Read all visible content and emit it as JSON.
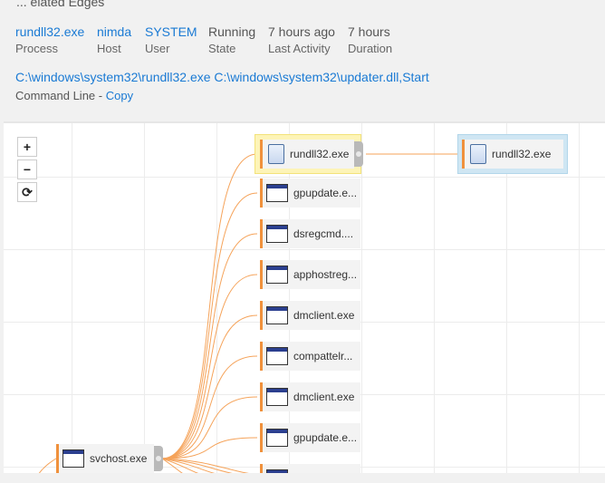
{
  "header_cut_text": "... elated Edges",
  "summary": {
    "fields": [
      {
        "value": "rundll32.exe",
        "label": "Process",
        "link": true
      },
      {
        "value": "nimda",
        "label": "Host",
        "link": true
      },
      {
        "value": "SYSTEM",
        "label": "User",
        "link": true
      },
      {
        "value": "Running",
        "label": "State",
        "link": false
      },
      {
        "value": "7 hours ago",
        "label": "Last Activity",
        "link": false
      },
      {
        "value": "7 hours",
        "label": "Duration",
        "link": false
      }
    ],
    "command_line": "C:\\windows\\system32\\rundll32.exe C:\\windows\\system32\\updater.dll,Start",
    "command_line_label": "Command Line - ",
    "copy_label": "Copy"
  },
  "graph": {
    "zoom_in": "+",
    "zoom_out": "−",
    "reset": "⟳",
    "root_node": "svchost.exe",
    "selected_node": "rundll32.exe",
    "related_node": "rundll32.exe",
    "children": [
      "gpupdate.e...",
      "dsregcmd....",
      "apphostreg...",
      "dmclient.exe",
      "compattelr...",
      "dmclient.exe",
      "gpupdate.e...",
      ""
    ],
    "colors": {
      "edge": "#f5a35a",
      "accent": "#f0913c",
      "selected_bg": "#fdf4b7",
      "related_bg": "#cfe6f3",
      "link": "#1a7ad4"
    }
  }
}
